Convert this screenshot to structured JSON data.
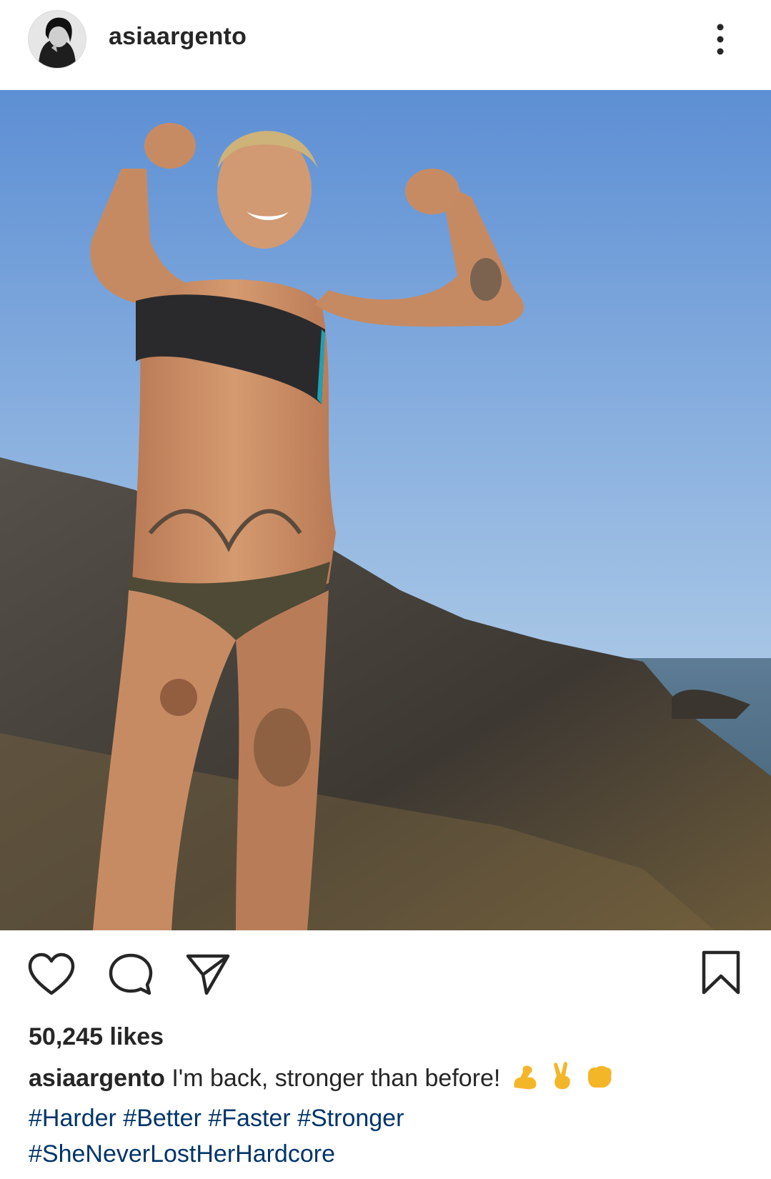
{
  "post": {
    "username": "asiaargento",
    "caption_text": "I'm back, stronger than before!",
    "caption_emojis": [
      "flexed-biceps-emoji",
      "victory-hand-emoji",
      "oncoming-fist-emoji"
    ],
    "hashtags_line1": [
      "#Harder",
      "#Better",
      "#Faster",
      "#Stronger"
    ],
    "hashtags_line2": [
      "#SheNeverLostHerHardcore"
    ],
    "likes": "50,245 likes"
  },
  "icons": {
    "more": "more-vertical-icon",
    "like": "heart-icon",
    "comment": "comment-icon",
    "share": "paper-plane-icon",
    "save": "bookmark-icon"
  },
  "colors": {
    "text": "#262626",
    "hashtag": "#003569",
    "sky_top": "#5d8fd4",
    "sky_bottom": "#c8dceb",
    "rock": "#3f3a33",
    "sea": "#4d6f88"
  }
}
